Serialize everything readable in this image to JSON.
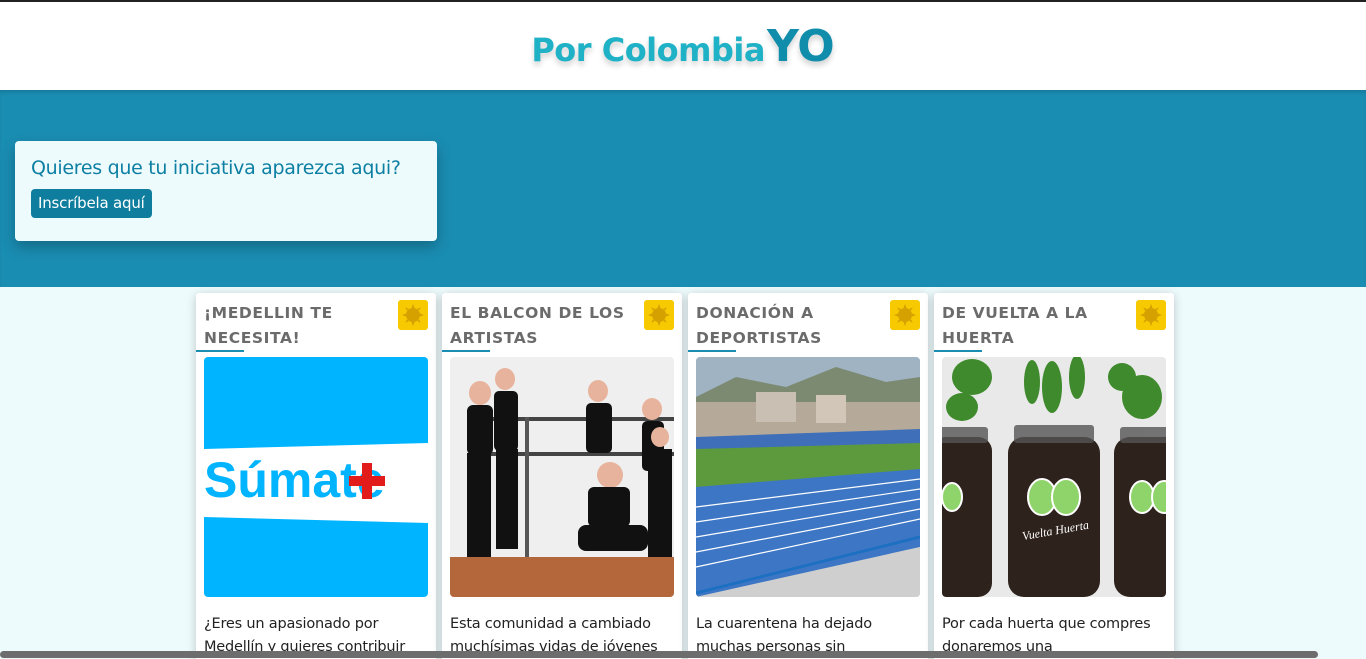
{
  "header": {
    "brand_main": "Por Colombia",
    "brand_suffix": "YO"
  },
  "hero": {
    "cta_title": "Quieres que tu iniciativa aparezca aqui?",
    "cta_button": "Inscríbela aquí"
  },
  "colors": {
    "brand_light": "#1fb1c5",
    "brand_dark": "#0f8dab",
    "hero_bg": "#1a8db2",
    "badge": "#f7c900"
  },
  "cards": [
    {
      "title": "¡MEDELLIN TE NECESITA!",
      "image_text": "Súmate",
      "badge_icon": "sun-icon",
      "description": "¿Eres un apasionado por Medellín y quieres contribuir"
    },
    {
      "title": "EL BALCON DE LOS ARTISTAS",
      "badge_icon": "sun-icon",
      "description": "Esta comunidad a cambiado muchísimas vidas de jóvenes"
    },
    {
      "title": "DONACIÓN A DEPORTISTAS",
      "badge_icon": "sun-icon",
      "description": "La cuarentena ha dejado muchas personas sin"
    },
    {
      "title": "DE VUELTA A LA HUERTA",
      "image_text": "Vuelta Huerta",
      "badge_icon": "sun-icon",
      "description": "Por cada huerta que compres donaremos una"
    }
  ]
}
